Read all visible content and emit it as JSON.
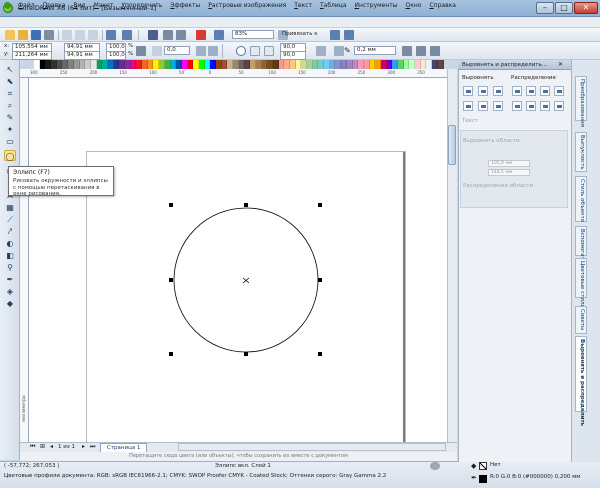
{
  "window": {
    "title": "CorelDRAW X6 (64 бит) - [Безымянный-1]",
    "minimize": "–",
    "maximize": "□",
    "close": "✕"
  },
  "menu": [
    {
      "accel": "Ф",
      "rest": "айл"
    },
    {
      "accel": "П",
      "rest": "равка"
    },
    {
      "accel": "В",
      "rest": "ид"
    },
    {
      "accel": "М",
      "rest": "акет"
    },
    {
      "accel": "У",
      "rest": "порядочить"
    },
    {
      "accel": "Э",
      "rest": "ффекты"
    },
    {
      "accel": "Р",
      "rest": "астровые изображения"
    },
    {
      "accel": "Т",
      "rest": "екст"
    },
    {
      "accel": "Т",
      "rest": "аблица"
    },
    {
      "accel": "И",
      "rest": "нструменты"
    },
    {
      "accel": "О",
      "rest": "кно"
    },
    {
      "accel": "С",
      "rest": "правка"
    }
  ],
  "toolbar1": {
    "zoom_value": "83%",
    "snap_label": "Привязать к"
  },
  "toolbar2": {
    "x_value": "105,554 мм",
    "y_value": "211,264 мм",
    "width_value": "94,91 мм",
    "height_value": "94,91 мм",
    "scale_x": "100,0",
    "scale_y": "100,0",
    "percent": "%",
    "rotation": "0,0",
    "arc_start": "90,0",
    "arc_end": "90,0",
    "outline_width": "0,2 мм"
  },
  "ruler": {
    "top_labels": [
      "300",
      "250",
      "200",
      "150",
      "100",
      "50",
      "0",
      "50",
      "100",
      "150",
      "200",
      "250",
      "300",
      "350"
    ],
    "left_label": "миллиметры"
  },
  "tooltip": {
    "title": "Эллипс (F7)",
    "description": "Рисовать окружности и эллипсы с помощью перетаскивания в окне рисования."
  },
  "page_nav": {
    "counter": "1 из 1",
    "tab": "Страница 1"
  },
  "hint_text": "Перетащите сюда цвета (или объекты), чтобы сохранить их вместе с документом",
  "status": {
    "coords": "( -57,772; 267,053 )",
    "selected": "Эллипс вкл. Слой 1",
    "profile": "Цветовые профили документа: RGB: sRGB IEC61966-2.1; CMYK: SWOP Proofer CMYK - Coated Stock; Оттенки серого: Gray Gamma 2.2",
    "fill": "Нет",
    "outline": "R:0 G:0 B:0 (#000000)  0,200 мм"
  },
  "docker": {
    "title": "Выровнять и распределить...",
    "align_label": "Выровнять",
    "distribute_label": "Распределение",
    "text_label": "Текст",
    "align_area_label": "Выровнять области",
    "field1": "105,0 мм",
    "field2": "148,5 мм",
    "distribute_area_label": "Распределение области"
  },
  "side_tabs": [
    "Преобразования",
    "Выпуклость",
    "Стиль объекта",
    "Вспомогательные",
    "Цветовые стили",
    "Советы",
    "Выровнять и распределить"
  ],
  "palette_colors": [
    "#ffffff",
    "#000000",
    "#1a1a1a",
    "#333333",
    "#4d4d4d",
    "#666666",
    "#808080",
    "#999999",
    "#b3b3b3",
    "#cccccc",
    "#e6e6e6",
    "#00a651",
    "#00a99d",
    "#0072bc",
    "#2e3192",
    "#662d91",
    "#92278f",
    "#ec008c",
    "#ed1c24",
    "#f26522",
    "#f7941d",
    "#fff200",
    "#8dc63f",
    "#39b54a",
    "#00aeef",
    "#0054a6",
    "#ff00ff",
    "#ff0000",
    "#ffff00",
    "#00ff00",
    "#00ffff",
    "#0000ff",
    "#8b4513",
    "#a0522d",
    "#c7b299",
    "#998675",
    "#736357",
    "#534741",
    "#c69c6d",
    "#a67c52",
    "#8c6239",
    "#754c24",
    "#603913",
    "#f5989d",
    "#f9ad81",
    "#fdc689",
    "#fff799",
    "#c4df9b",
    "#a3d39c",
    "#82ca9c",
    "#7accc8",
    "#6dcff6",
    "#7da7d9",
    "#8393ca",
    "#8781bd",
    "#a186be",
    "#bd8cbf",
    "#f49ac1",
    "#f6989d",
    "#ffcc00",
    "#ff9900",
    "#cc0066",
    "#6600cc",
    "#3399ff",
    "#66cc66",
    "#99ff99",
    "#ccffcc",
    "#ffcccc",
    "#ffe6cc",
    "#e6f2ff",
    "#444466",
    "#664444"
  ],
  "ellipse_tool_hint": "Эллипс"
}
